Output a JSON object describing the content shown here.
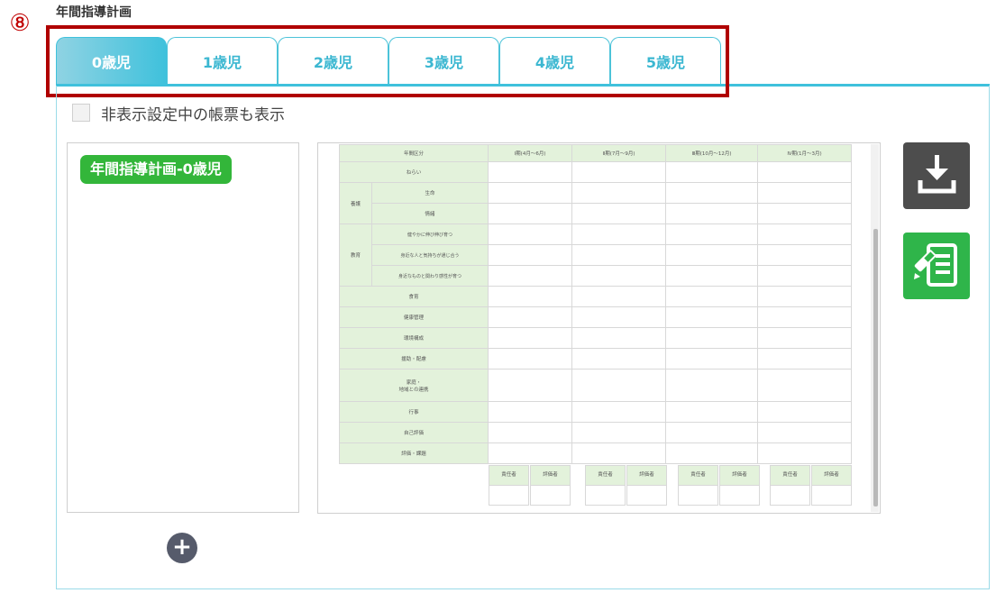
{
  "section": {
    "title": "年間指導計画",
    "marker": "⑧"
  },
  "tabs": [
    {
      "label": "0歳児",
      "active": true
    },
    {
      "label": "1歳児",
      "active": false
    },
    {
      "label": "2歳児",
      "active": false
    },
    {
      "label": "3歳児",
      "active": false
    },
    {
      "label": "4歳児",
      "active": false
    },
    {
      "label": "5歳児",
      "active": false
    }
  ],
  "filter": {
    "show_hidden_label": "非表示設定中の帳票も表示",
    "checked": false
  },
  "documents": [
    {
      "label": "年間指導計画-0歳児"
    }
  ],
  "preview": {
    "header": {
      "term_col": "年間区分",
      "periods": [
        "Ⅰ期(4月～6月)",
        "Ⅱ期(7月～9月)",
        "Ⅲ期(10月～12月)",
        "Ⅳ期(1月～3月)"
      ]
    },
    "rows": {
      "aim": "ねらい",
      "care": "養護",
      "care_life": "生命",
      "care_emotion": "情緒",
      "education": "教育",
      "edu_1": "健やかに伸び伸び育つ",
      "edu_2": "身近な人と気持ちが通じ合う",
      "edu_3": "身近なものと関わり感性が育つ",
      "food": "食育",
      "health": "健康管理",
      "environment": "環境構成",
      "support": "援助・配慮",
      "family": "家庭・",
      "family_2": "地域との連携",
      "events": "行事",
      "self_eval": "自己評価",
      "eval": "評価・課題"
    },
    "sign": {
      "responsible": "責任者",
      "evaluator": "評価者"
    }
  },
  "actions": {
    "download_icon": "download-icon",
    "edit_icon": "edit-note-icon"
  },
  "colors": {
    "accent": "#3fc1dc",
    "highlight": "#b00000",
    "chip": "#33b63a",
    "download_bg": "#4d4d4d",
    "edit_bg": "#2fb54a"
  }
}
